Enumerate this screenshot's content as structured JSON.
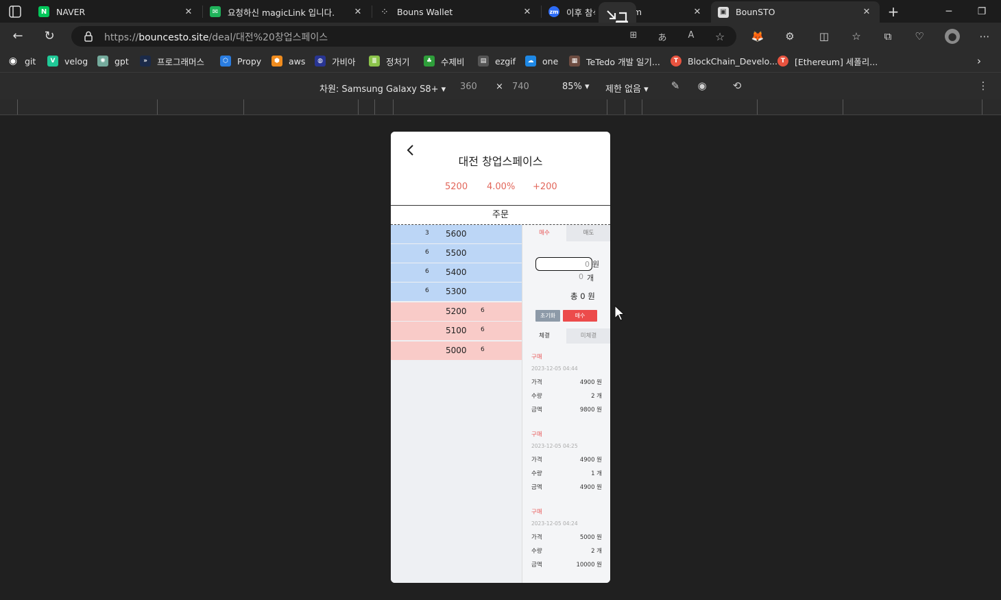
{
  "browser": {
    "tabs": [
      {
        "title": "NAVER",
        "favicon": "naver-icon",
        "color": "#03c75a",
        "glyph": "N"
      },
      {
        "title": "요청하신 magicLink 입니다.",
        "favicon": "mail-icon",
        "color": "#1fb35a",
        "glyph": "✉"
      },
      {
        "title": "Bouns Wallet",
        "favicon": "loading-dots-icon",
        "color": "#1c1c1c",
        "glyph": "⁘"
      },
      {
        "title": "이후 참석",
        "favicon": "zoom-icon",
        "color": "#2d6cf6",
        "glyph": "zm"
      },
      {
        "title": "BounSTO",
        "favicon": "bounsto-icon",
        "color": "#e6e6e6",
        "glyph": "▣"
      }
    ],
    "tab_suffix_partial": "m",
    "url_prefix": "https://",
    "url_host": "bouncesto.site",
    "url_path": "/deal/대전%20창업스페이스",
    "bookmarks": [
      {
        "label": "git",
        "icon": "github-icon",
        "color": "#1c1c1c",
        "glyph": "◉"
      },
      {
        "label": "velog",
        "icon": "velog-icon",
        "color": "#20c997",
        "glyph": "V"
      },
      {
        "label": "gpt",
        "icon": "chatgpt-icon",
        "color": "#74aa9c",
        "glyph": "✺"
      },
      {
        "label": "프로그래머스",
        "icon": "programmers-icon",
        "color": "#1b2a49",
        "glyph": "»"
      },
      {
        "label": "Propy",
        "icon": "propy-icon",
        "color": "#2a7de1",
        "glyph": "⬡"
      },
      {
        "label": "aws",
        "icon": "aws-icon",
        "color": "#f08c1e",
        "glyph": "⬢"
      },
      {
        "label": "가비아",
        "icon": "gabia-icon",
        "color": "#283593",
        "glyph": "◍"
      },
      {
        "label": "정처기",
        "icon": "exam-icon",
        "color": "#8bc34a",
        "glyph": "≣"
      },
      {
        "label": "수제비",
        "icon": "sujebi-icon",
        "color": "#2e9e3a",
        "glyph": "♣"
      },
      {
        "label": "ezgif",
        "icon": "ezgif-icon",
        "color": "#555",
        "glyph": "▤"
      },
      {
        "label": "one",
        "icon": "onedrive-icon",
        "color": "#1e88e5",
        "glyph": "☁"
      },
      {
        "label": "TeTedo 개발 일기...",
        "icon": "blog-icon",
        "color": "#6d4c41",
        "glyph": "▦"
      },
      {
        "label": "BlockChain_Develo...",
        "icon": "tistory-icon",
        "color": "#e8533f",
        "glyph": "T"
      },
      {
        "label": "[Ethereum] 세폴리...",
        "icon": "tistory-icon",
        "color": "#e8533f",
        "glyph": "T"
      }
    ],
    "devtools": {
      "device_label": "차원: Samsung Galaxy S8+",
      "width": "360",
      "times": "×",
      "height": "740",
      "zoom": "85%",
      "throttle": "제한 없음"
    }
  },
  "app": {
    "title": "대전 창업스페이스",
    "stats": {
      "price": "5200",
      "rate": "4.00%",
      "change": "+200"
    },
    "order_label": "주문",
    "orderbook": {
      "asks": [
        {
          "qty": "3",
          "price": "5600"
        },
        {
          "qty": "6",
          "price": "5500"
        },
        {
          "qty": "6",
          "price": "5400"
        },
        {
          "qty": "6",
          "price": "5300"
        }
      ],
      "bids": [
        {
          "price": "5200",
          "qty": "6"
        },
        {
          "price": "5100",
          "qty": "6"
        },
        {
          "price": "5000",
          "qty": "6"
        }
      ]
    },
    "panel": {
      "buy_tab": "매수",
      "sell_tab": "매도",
      "price_value": "0",
      "price_unit": "원",
      "qty_value": "0",
      "qty_unit": "개",
      "total_label": "총",
      "total_value": "0",
      "total_unit": "원",
      "reset_button": "초기화",
      "buy_button": "매수",
      "filled_tab": "체결",
      "unfilled_tab": "미체결"
    },
    "trades": [
      {
        "kind": "구매",
        "time": "2023-12-05 04:44",
        "price_label": "가격",
        "price": "4900 원",
        "qty_label": "수량",
        "qty": "2 개",
        "amount_label": "금액",
        "amount": "9800 원"
      },
      {
        "kind": "구매",
        "time": "2023-12-05 04:25",
        "price_label": "가격",
        "price": "4900 원",
        "qty_label": "수량",
        "qty": "1 개",
        "amount_label": "금액",
        "amount": "4900 원"
      },
      {
        "kind": "구매",
        "time": "2023-12-05 04:24",
        "price_label": "가격",
        "price": "5000 원",
        "qty_label": "수량",
        "qty": "2 개",
        "amount_label": "금액",
        "amount": "10000 원"
      }
    ]
  },
  "colors": {
    "ask": "#bcd6f6",
    "bid": "#f9cbc8",
    "accent": "#e85a5a"
  }
}
